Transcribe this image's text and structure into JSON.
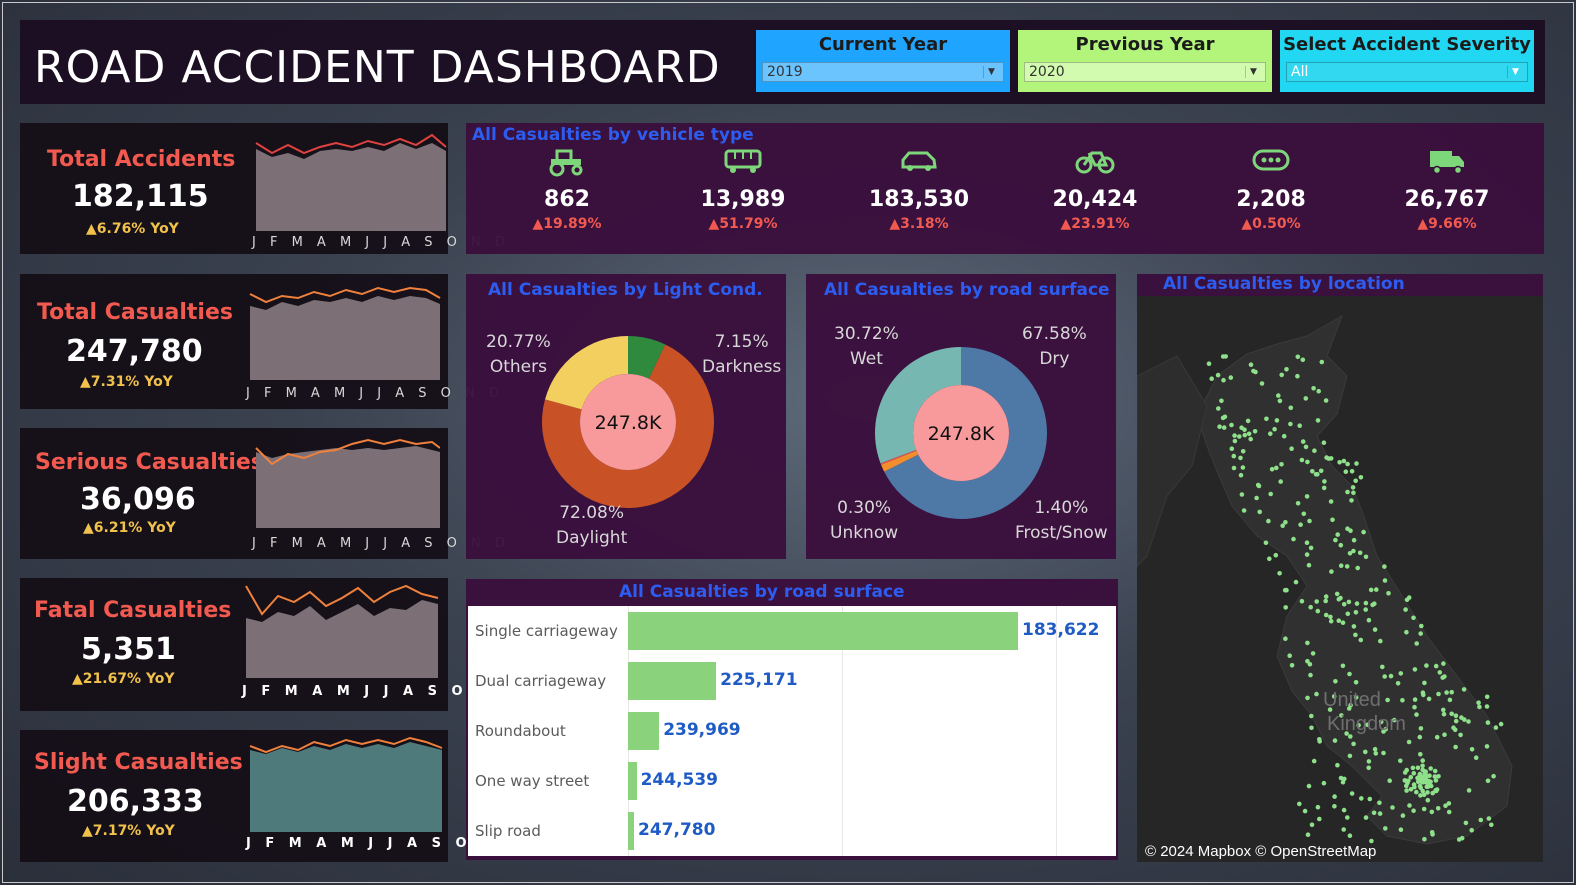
{
  "header": {
    "title": "ROAD ACCIDENT DASHBOARD",
    "filters": [
      {
        "label": "Current Year",
        "value": "2019",
        "color": "#1fa4ff"
      },
      {
        "label": "Previous Year",
        "value": "2020",
        "color": "#b2f57a"
      },
      {
        "label": "Select Accident Severity",
        "value": "All",
        "color": "#21d7f2"
      }
    ]
  },
  "kpis": [
    {
      "label": "Total Accidents",
      "value": "182,115",
      "yoy": "▲6.76% YoY",
      "months": "J F M A M J J A S O N D"
    },
    {
      "label": "Total Casualties",
      "value": "247,780",
      "yoy": "▲7.31% YoY",
      "months": "J F M A M J J A S O N D"
    },
    {
      "label": "Serious Casualties",
      "value": "36,096",
      "yoy": "▲6.21% YoY",
      "months": "J F M A M J J A S O N D"
    },
    {
      "label": "Fatal Casualties",
      "value": "5,351",
      "yoy": "▲21.67% YoY",
      "months": "J F M A M J J A S O N D"
    },
    {
      "label": "Slight Casualties",
      "value": "206,333",
      "yoy": "▲7.17% YoY",
      "months": "J F M A M J J A S O N D"
    }
  ],
  "vehicle_section": {
    "title": "All Casualties by vehicle type",
    "items": [
      {
        "icon": "tractor-icon",
        "value": "862",
        "pct": "▲19.89%"
      },
      {
        "icon": "bus-icon",
        "value": "13,989",
        "pct": "▲51.79%"
      },
      {
        "icon": "car-icon",
        "value": "183,530",
        "pct": "▲3.18%"
      },
      {
        "icon": "bicycle-icon",
        "value": "20,424",
        "pct": "▲23.91%"
      },
      {
        "icon": "other-vehicle-icon",
        "value": "2,208",
        "pct": "▲0.50%"
      },
      {
        "icon": "van-icon",
        "value": "26,767",
        "pct": "▲9.66%"
      }
    ]
  },
  "light_cond": {
    "title": "All   Casualties  by Light Cond.",
    "center": "247.8K",
    "labels": {
      "others_pct": "20.77%",
      "others": "Others",
      "dark_pct": "7.15%",
      "dark": "Darkness",
      "day_pct": "72.08%",
      "day": "Daylight"
    }
  },
  "road_surface": {
    "title": "All Casualties by road surface",
    "center": "247.8K",
    "labels": {
      "wet_pct": "30.72%",
      "wet": "Wet",
      "dry_pct": "67.58%",
      "dry": "Dry",
      "unk_pct": "0.30%",
      "unk": "Unknow",
      "frost_pct": "1.40%",
      "frost": "Frost/Snow"
    }
  },
  "road_type": {
    "title": "All Casualties by road surface",
    "bars": [
      {
        "label": "Single carriageway",
        "value": "183,622"
      },
      {
        "label": "Dual carriageway",
        "value": "225,171"
      },
      {
        "label": "Roundabout",
        "value": "239,969"
      },
      {
        "label": "One way street",
        "value": "244,539"
      },
      {
        "label": "Slip road",
        "value": "247,780"
      }
    ]
  },
  "location": {
    "title": "All Casualties by location",
    "map_label": "United Kingdom",
    "credit": "© 2024 Mapbox © OpenStreetMap"
  },
  "colors": {
    "accent_red": "#f25a50",
    "accent_blue": "#2c5df0",
    "bar_green": "#8ad27c",
    "dot_green": "#8fe08a",
    "spark_line": "#f0813c"
  },
  "chart_data": [
    {
      "type": "pie",
      "title": "All   Casualties  by Light Cond.",
      "categories": [
        "Darkness",
        "Daylight",
        "Others"
      ],
      "values": [
        7.15,
        72.08,
        20.77
      ],
      "colors": [
        "#2f8a3e",
        "#c85226",
        "#f2cf5e"
      ]
    },
    {
      "type": "pie",
      "title": "All Casualties by road surface",
      "categories": [
        "Dry",
        "Frost/Snow",
        "Unknow",
        "Wet"
      ],
      "values": [
        67.58,
        1.4,
        0.3,
        30.72
      ],
      "colors": [
        "#4e79a7",
        "#f28e2b",
        "#e15759",
        "#76b7b2"
      ]
    },
    {
      "type": "bar",
      "title": "All Casualties by road surface",
      "categories": [
        "Single carriageway",
        "Dual carriageway",
        "Roundabout",
        "One way street",
        "Slip road"
      ],
      "values": [
        183622,
        225171,
        239969,
        244539,
        247780
      ]
    }
  ]
}
